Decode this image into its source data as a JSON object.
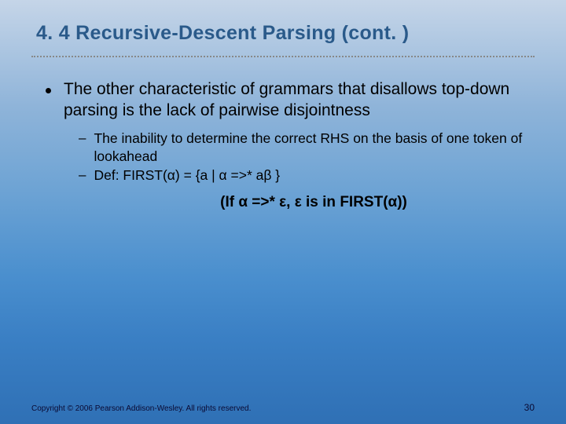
{
  "title": "4. 4 Recursive-Descent Parsing (cont. )",
  "bullet1": "The other characteristic of grammars that disallows top-down parsing is the lack of pairwise disjointness",
  "sub1": "The inability to determine the correct RHS on the basis of one token of lookahead",
  "sub2": "Def: FIRST(α) = {a | α =>* aβ }",
  "center": "(If α =>* ε, ε is in FIRST(α))",
  "copyright": "Copyright © 2006 Pearson Addison-Wesley. All rights reserved.",
  "page": "30"
}
